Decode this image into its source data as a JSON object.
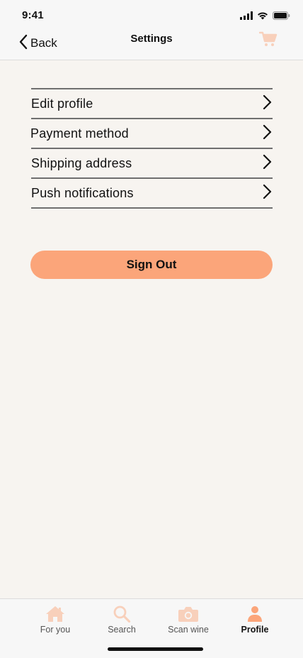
{
  "status_bar": {
    "time": "9:41"
  },
  "nav": {
    "back_label": "Back",
    "title": "Settings",
    "cart_icon": "cart-icon"
  },
  "settings": {
    "items": [
      {
        "label": "Edit profile"
      },
      {
        "label": "Payment method"
      },
      {
        "label": "Shipping address"
      },
      {
        "label": "Push notifications"
      }
    ]
  },
  "sign_out": {
    "label": "Sign Out"
  },
  "tab_bar": {
    "tabs": [
      {
        "label": "For you",
        "icon": "home-icon",
        "active": false
      },
      {
        "label": "Search",
        "icon": "search-icon",
        "active": false
      },
      {
        "label": "Scan wine",
        "icon": "camera-icon",
        "active": false
      },
      {
        "label": "Profile",
        "icon": "person-icon",
        "active": true
      }
    ]
  },
  "colors": {
    "accent": "#fba57a",
    "accent_faded": "#f8d0bb",
    "background": "#f7f4f0",
    "bar_background": "#f7f7f7"
  }
}
